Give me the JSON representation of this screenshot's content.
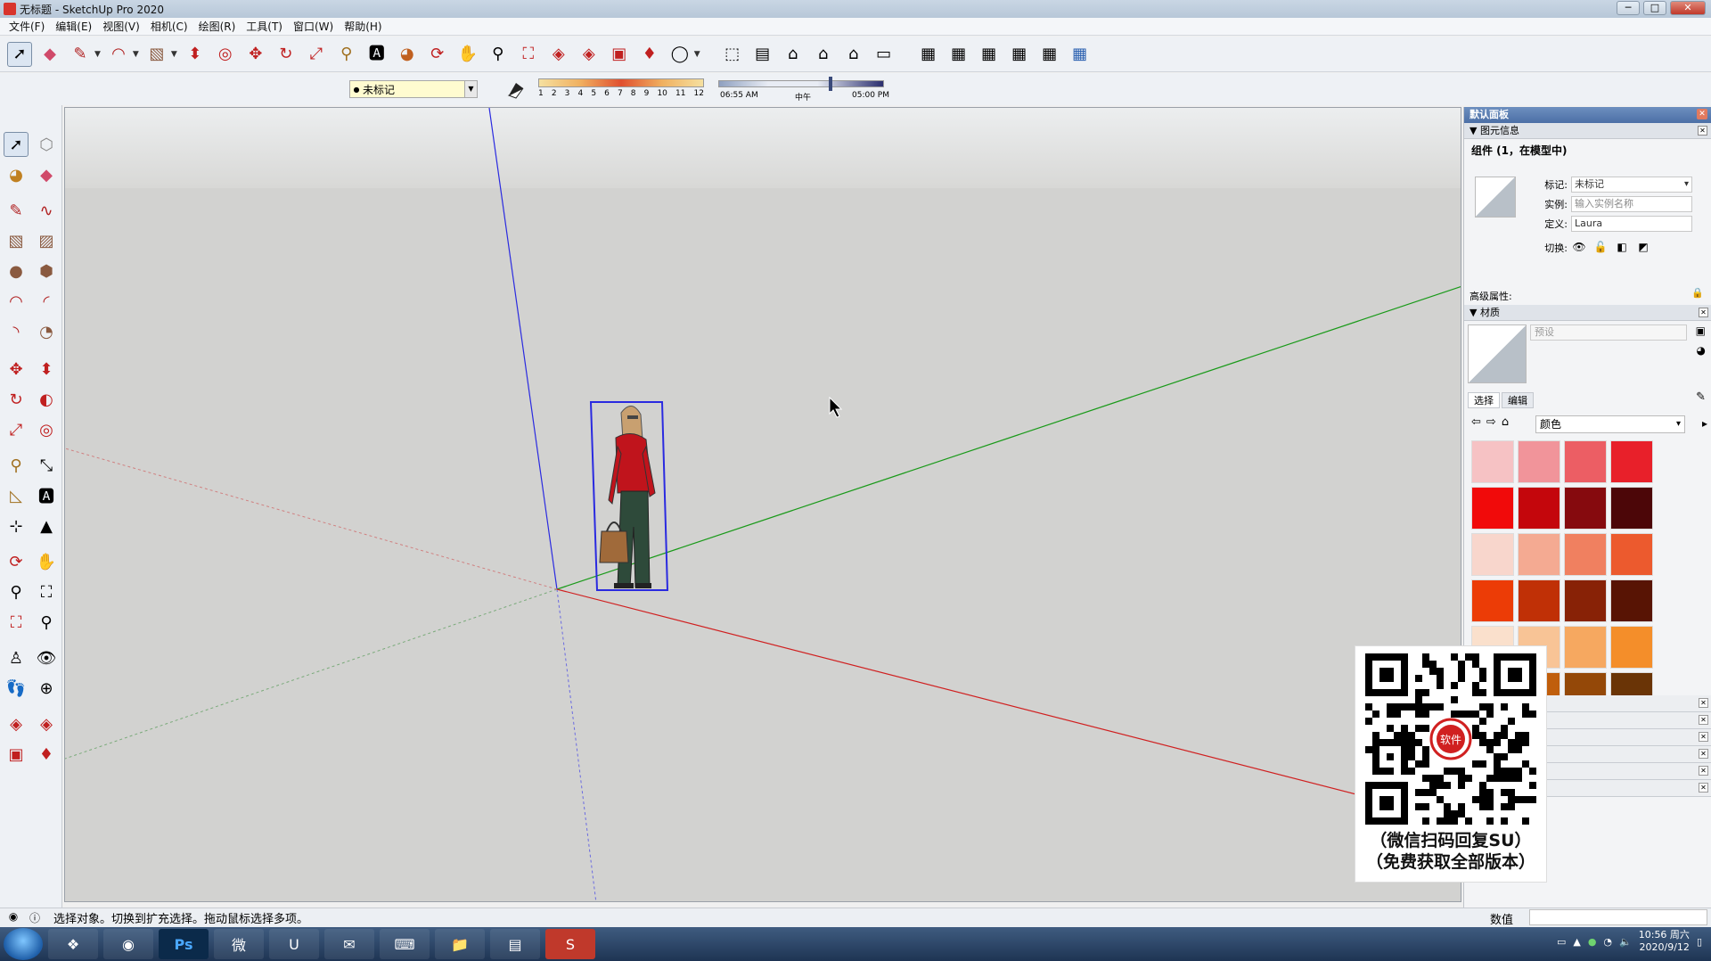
{
  "window": {
    "title": "无标题 - SketchUp Pro 2020",
    "min_label": "─",
    "max_label": "□",
    "close_label": "✕"
  },
  "menu": [
    "文件(F)",
    "编辑(E)",
    "视图(V)",
    "相机(C)",
    "绘图(R)",
    "工具(T)",
    "窗口(W)",
    "帮助(H)"
  ],
  "tag_selector": {
    "value": "未标记"
  },
  "shadow_settings": {
    "months": [
      "1",
      "2",
      "3",
      "4",
      "5",
      "6",
      "7",
      "8",
      "9",
      "10",
      "11",
      "12"
    ],
    "time_start": "06:55 AM",
    "time_mid": "中午",
    "time_end": "05:00 PM"
  },
  "tray": {
    "title": "默认面板",
    "entity_info": {
      "section_label": "图元信息",
      "header": "组件 (1，在模型中)",
      "tag_label": "标记:",
      "tag_value": "未标记",
      "instance_label": "实例:",
      "instance_placeholder": "输入实例名称",
      "definition_label": "定义:",
      "definition_value": "Laura",
      "toggles_label": "切换:",
      "advanced_label": "高级属性:"
    },
    "materials": {
      "section_label": "材质",
      "name_placeholder": "预设",
      "tab_select": "选择",
      "tab_edit": "编辑",
      "category": "颜色",
      "swatches": [
        "#f6c2c4",
        "#f1949a",
        "#ec5e64",
        "#e8202a",
        "#f10a0a",
        "#c4060c",
        "#860a0e",
        "#4c0608",
        "#f8d6cc",
        "#f4aa92",
        "#f08060",
        "#ec5a2e",
        "#ec3c06",
        "#c03006",
        "#882206",
        "#581404",
        "#fae0cc",
        "#f8c496",
        "#f6a860",
        "#f48e2a",
        "#e07010",
        "#c05e0c",
        "#944808",
        "#6a3406"
      ]
    }
  },
  "qr_overlay": {
    "caption_line1": "（微信扫码回复SU）",
    "caption_line2": "（免费获取全部版本）",
    "badge_text": "软件"
  },
  "statusbar": {
    "hint": "选择对象。切换到扩充选择。拖动鼠标选择多项。",
    "measure_label": "数值"
  },
  "taskbar": {
    "apps": [
      "Ps",
      "微",
      "U",
      "✉",
      "⌨",
      "📁",
      "▤",
      "S"
    ],
    "time": "10:56 周六",
    "date": "2020/9/12"
  }
}
